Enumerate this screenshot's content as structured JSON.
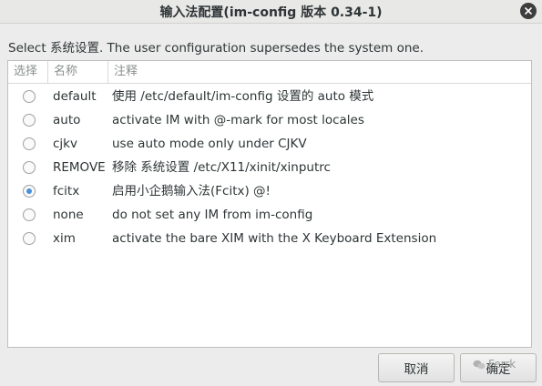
{
  "window": {
    "title": "输入法配置(im-config 版本 0.34-1)"
  },
  "instruction": "Select 系统设置. The user configuration supersedes the system one.",
  "columns": [
    "选择",
    "名称",
    "注释"
  ],
  "rows": [
    {
      "name": "default",
      "desc": "使用 /etc/default/im-config 设置的 auto 模式",
      "selected": false
    },
    {
      "name": "auto",
      "desc": "activate IM with @-mark for most locales",
      "selected": false
    },
    {
      "name": "cjkv",
      "desc": "use auto mode only under CJKV",
      "selected": false
    },
    {
      "name": "REMOVE",
      "desc": "移除 系统设置 /etc/X11/xinit/xinputrc",
      "selected": false
    },
    {
      "name": "fcitx",
      "desc": "启用小企鹅输入法(Fcitx) @!",
      "selected": true
    },
    {
      "name": "none",
      "desc": "do not set any IM from im-config",
      "selected": false
    },
    {
      "name": "xim",
      "desc": "activate the bare XIM with the X Keyboard Extension",
      "selected": false
    }
  ],
  "buttons": {
    "cancel": "取消",
    "ok": "确定"
  },
  "watermark": "Ferrk",
  "colors": {
    "accent": "#4a90d9",
    "window_bg": "#ececec"
  },
  "icons": {
    "close": "close-icon",
    "watermark_logo": "wechat-logo-icon"
  }
}
